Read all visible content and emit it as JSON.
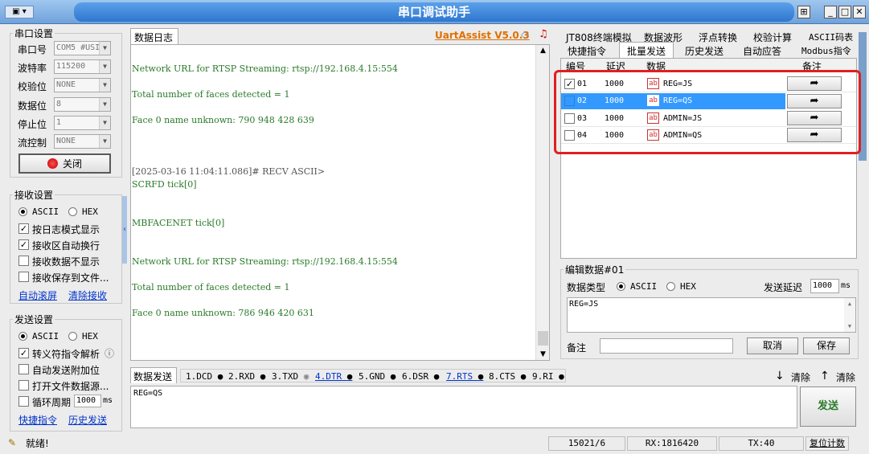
{
  "window": {
    "title": "串口调试助手"
  },
  "serial": {
    "group_title": "串口设置",
    "rows": [
      {
        "label": "串口号",
        "value": "COM5 #USI"
      },
      {
        "label": "波特率",
        "value": "115200"
      },
      {
        "label": "校验位",
        "value": "NONE"
      },
      {
        "label": "数据位",
        "value": "8"
      },
      {
        "label": "停止位",
        "value": "1"
      },
      {
        "label": "流控制",
        "value": "NONE"
      }
    ],
    "close_button": "关闭"
  },
  "receive": {
    "group_title": "接收设置",
    "ascii": "ASCII",
    "hex": "HEX",
    "options": [
      "按日志模式显示",
      "接收区自动换行",
      "接收数据不显示",
      "接收保存到文件..."
    ],
    "auto_scroll": "自动滚屏",
    "clear_receive": "清除接收"
  },
  "send_settings": {
    "group_title": "发送设置",
    "ascii": "ASCII",
    "hex": "HEX",
    "options": [
      "转义符指令解析",
      "自动发送附加位",
      "打开文件数据源...",
      "循环周期"
    ],
    "period_value": "1000",
    "period_unit": "ms",
    "shortcut": "快捷指令",
    "history": "历史发送",
    "info_icon": "ⓘ"
  },
  "log": {
    "tab": "数据日志",
    "brand": "UartAssist V5.0.3",
    "lines": [
      "Network URL for RTSP Streaming: rtsp://192.168.4.15:554",
      "Total number of faces detected = 1",
      "Face 0 name unknown:    790 948 428 639",
      "[2025-03-16 11:04:11.086]# RECV ASCII>",
      "SCRFD tick[0]",
      "MBFACENET tick[0]",
      "Network URL for RTSP Streaming: rtsp://192.168.4.15:554",
      "Total number of faces detected = 1",
      "Face 0 name unknown:    786 946 420 631"
    ]
  },
  "right_tabs": {
    "row1": [
      "JT808终端模拟",
      "数据波形",
      "浮点转换",
      "校验计算",
      "ASCII码表"
    ],
    "row2": [
      "快捷指令",
      "批量发送",
      "历史发送",
      "自动应答",
      "Modbus指令"
    ]
  },
  "batch": {
    "headers": [
      "编号",
      "延迟",
      "数据",
      "备注"
    ],
    "rows": [
      {
        "no": "01",
        "delay": "1000",
        "data": "REG=JS",
        "checked": true
      },
      {
        "no": "02",
        "delay": "1000",
        "data": "REG=QS",
        "checked": false
      },
      {
        "no": "03",
        "delay": "1000",
        "data": "ADMIN=JS",
        "checked": false
      },
      {
        "no": "04",
        "delay": "1000",
        "data": "ADMIN=QS",
        "checked": false
      }
    ],
    "icon_text": "ab"
  },
  "edit": {
    "group_title": "编辑数据#01",
    "type_label": "数据类型",
    "ascii": "ASCII",
    "hex": "HEX",
    "delay_label": "发送延迟",
    "delay_value": "1000",
    "delay_unit": "ms",
    "content": "REG=JS",
    "note_label": "备注",
    "cancel": "取消",
    "save": "保存"
  },
  "send_bar": {
    "tab": "数据发送",
    "signals": [
      "1.DCD",
      "2.RXD",
      "3.TXD",
      "4.DTR",
      "5.GND",
      "6.DSR",
      "7.RTS",
      "8.CTS",
      "9.RI"
    ],
    "clear1": "清除",
    "clear2": "清除",
    "content": "REG=QS",
    "send_button": "发送"
  },
  "status": {
    "ready": "就绪!",
    "count": "15021/6",
    "rx": "RX:1816420",
    "tx": "TX:40",
    "reset": "复位计数"
  },
  "colors": {
    "highlight": "#e02020",
    "selected_row": "#3399ff",
    "log_text": "#2a7a2a",
    "link": "#0033cc"
  }
}
